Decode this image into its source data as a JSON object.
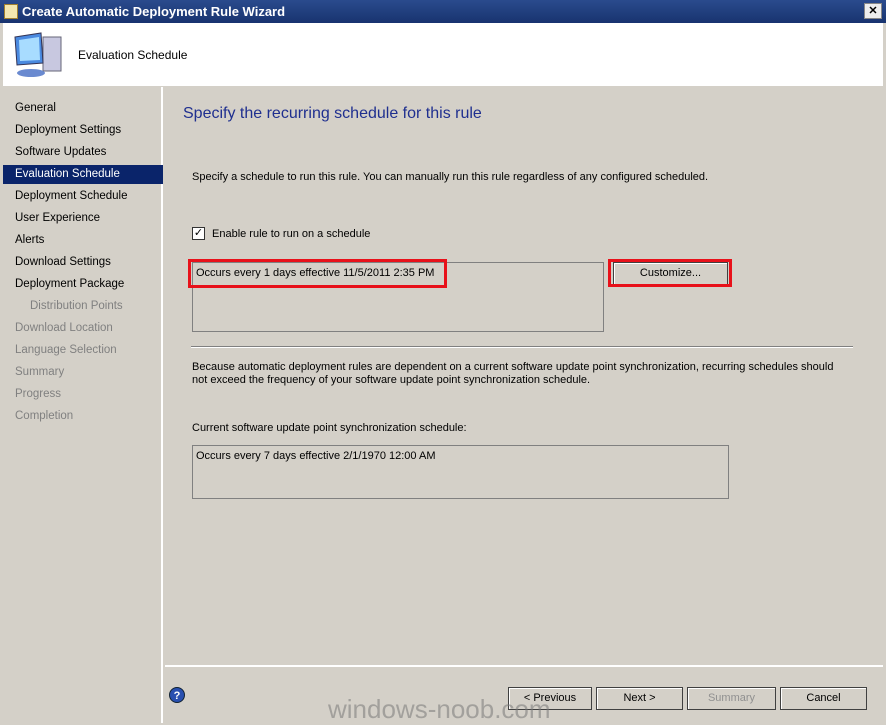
{
  "window": {
    "title": "Create Automatic Deployment Rule Wizard",
    "close": "✕"
  },
  "header": {
    "title": "Evaluation Schedule"
  },
  "sidebar": {
    "items": [
      {
        "label": "General",
        "state": "normal"
      },
      {
        "label": "Deployment Settings",
        "state": "normal"
      },
      {
        "label": "Software Updates",
        "state": "normal"
      },
      {
        "label": "Evaluation Schedule",
        "state": "selected"
      },
      {
        "label": "Deployment Schedule",
        "state": "normal"
      },
      {
        "label": "User Experience",
        "state": "normal"
      },
      {
        "label": "Alerts",
        "state": "normal"
      },
      {
        "label": "Download Settings",
        "state": "normal"
      },
      {
        "label": "Deployment Package",
        "state": "normal"
      },
      {
        "label": "Distribution Points",
        "state": "disabled",
        "indent": true
      },
      {
        "label": "Download Location",
        "state": "disabled"
      },
      {
        "label": "Language Selection",
        "state": "disabled"
      },
      {
        "label": "Summary",
        "state": "disabled"
      },
      {
        "label": "Progress",
        "state": "disabled"
      },
      {
        "label": "Completion",
        "state": "disabled"
      }
    ]
  },
  "main": {
    "heading": "Specify the recurring schedule for this rule",
    "intro": "Specify a schedule to run this rule. You can manually run this rule regardless of any configured scheduled.",
    "enable_label": "Enable rule to run on a schedule",
    "enable_checked": true,
    "schedule": "Occurs every 1 days effective 11/5/2011 2:35 PM",
    "customize": "Customize...",
    "note": "Because automatic deployment rules are dependent on a current software update point synchronization, recurring schedules should not exceed the frequency of your software update point synchronization schedule.",
    "sync_label": "Current software update point synchronization schedule:",
    "sync_schedule": "Occurs every 7 days effective 2/1/1970 12:00 AM"
  },
  "footer": {
    "previous": "< Previous",
    "next": "Next >",
    "summary": "Summary",
    "cancel": "Cancel"
  },
  "watermark": "windows-noob.com",
  "colors": {
    "highlight": "#e8111a",
    "selection": "#0a246a"
  }
}
